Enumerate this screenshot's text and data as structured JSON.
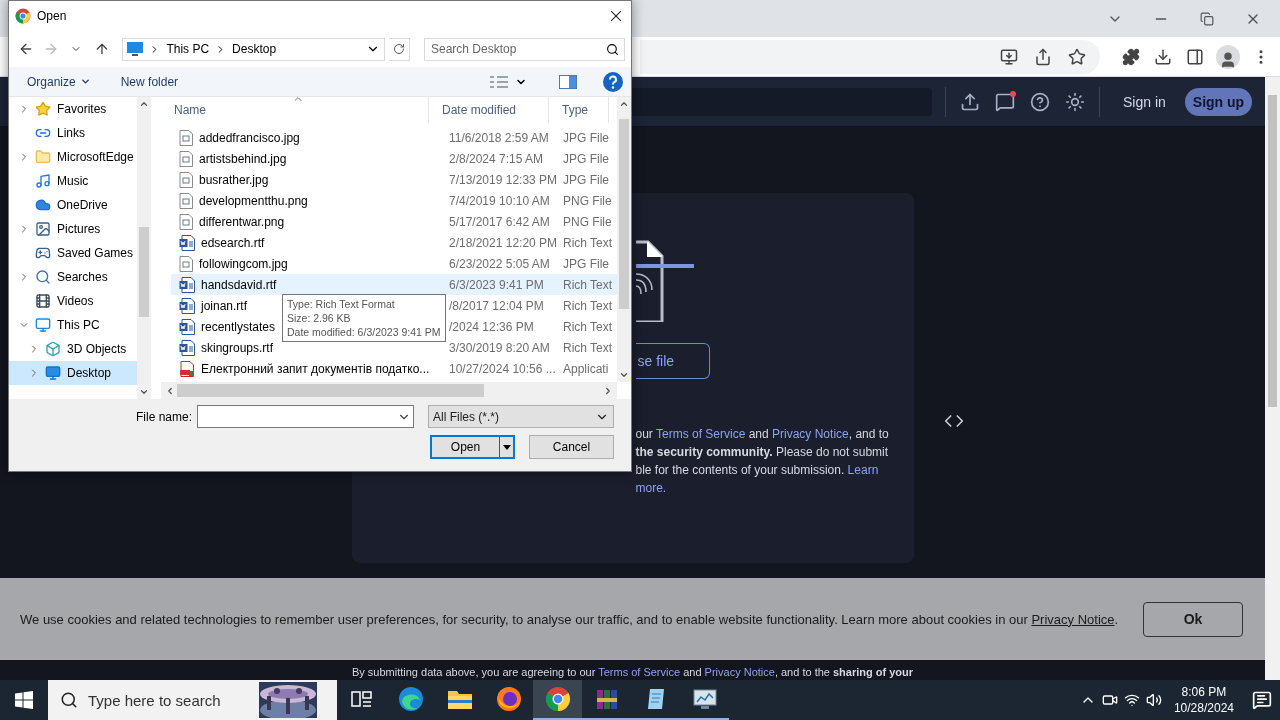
{
  "site_header": {
    "sign_in": "Sign in",
    "sign_up": "Sign up"
  },
  "upload_card": {
    "choose_button": "se file",
    "terms_lines": [
      [
        {
          "kind": "text",
          "text": "our "
        },
        {
          "kind": "link",
          "text": "Terms of Service"
        },
        {
          "kind": "text",
          "text": " and "
        },
        {
          "kind": "link",
          "text": "Privacy Notice"
        },
        {
          "kind": "text",
          "text": ", and to"
        }
      ],
      [
        {
          "kind": "text",
          "text": "**the security community.** Please do not submit"
        }
      ],
      [
        {
          "kind": "text",
          "text": "ble for the contents of your submission. "
        },
        {
          "kind": "link",
          "text": "Learn"
        }
      ],
      [
        {
          "kind": "link",
          "text": "more."
        }
      ]
    ]
  },
  "footer_text": [
    {
      "kind": "text",
      "text": "By submitting data above, you are agreeing to our "
    },
    {
      "kind": "link",
      "text": "Terms of Service"
    },
    {
      "kind": "text",
      "text": " and "
    },
    {
      "kind": "link",
      "text": "Privacy Notice"
    },
    {
      "kind": "text",
      "text": ", and to the **sharing of your**"
    }
  ],
  "cookie_banner": {
    "text": [
      {
        "kind": "text",
        "text": "We use cookies and related technologies to remember user preferences, for security, to analyse our traffic, and to enable website functionality. Learn more about cookies in our "
      },
      {
        "kind": "link",
        "text": "Privacy Notice"
      },
      {
        "kind": "text",
        "text": "."
      }
    ],
    "ok": "Ok"
  },
  "dialog": {
    "title": "Open",
    "breadcrumb": [
      "This PC",
      "Desktop"
    ],
    "search_placeholder": "Search Desktop",
    "organize": "Organize",
    "new_folder": "New folder",
    "tree": [
      {
        "label": "Favorites",
        "kind": "star",
        "expanded": false,
        "selected": false
      },
      {
        "label": "Links",
        "kind": "link",
        "selected": false
      },
      {
        "label": "MicrosoftEdge",
        "kind": "folder",
        "expanded": false,
        "selected": false
      },
      {
        "label": "Music",
        "kind": "music",
        "selected": false
      },
      {
        "label": "OneDrive",
        "kind": "cloud",
        "selected": false
      },
      {
        "label": "Pictures",
        "kind": "pictures",
        "expanded": false,
        "selected": false
      },
      {
        "label": "Saved Games",
        "kind": "games",
        "selected": false
      },
      {
        "label": "Searches",
        "kind": "search",
        "expanded": false,
        "selected": false
      },
      {
        "label": "Videos",
        "kind": "videos",
        "selected": false
      },
      {
        "label": "This PC",
        "kind": "pc",
        "expanded": true,
        "selected": false,
        "children": [
          {
            "label": "3D Objects",
            "kind": "cube",
            "expanded": false,
            "selected": false
          },
          {
            "label": "Desktop",
            "kind": "desktop",
            "expanded": false,
            "selected": true
          }
        ]
      }
    ],
    "columns": [
      "Name",
      "Date modified",
      "Type"
    ],
    "files": [
      {
        "name": "addedfrancisco.jpg",
        "modified": "11/6/2018 2:59 AM",
        "type": "JPG File",
        "hovered": false
      },
      {
        "name": "artistsbehind.jpg",
        "modified": "2/8/2024 7:15 AM",
        "type": "JPG File",
        "hovered": false
      },
      {
        "name": "busrather.jpg",
        "modified": "7/13/2019 12:33 PM",
        "type": "JPG File",
        "hovered": false
      },
      {
        "name": "developmentthu.png",
        "modified": "7/4/2019 10:10 AM",
        "type": "PNG File",
        "hovered": false
      },
      {
        "name": "differentwar.png",
        "modified": "5/17/2017 6:42 AM",
        "type": "PNG File",
        "hovered": false
      },
      {
        "name": "edsearch.rtf",
        "modified": "2/18/2021 12:20 PM",
        "type": "Rich Text",
        "kind": "document",
        "hovered": false
      },
      {
        "name": "followingcom.jpg",
        "modified": "6/23/2022 5:05 AM",
        "type": "JPG File",
        "hovered": false
      },
      {
        "name": "handsdavid.rtf",
        "modified": "6/3/2023 9:41 PM",
        "type": "Rich Text",
        "kind": "document",
        "hovered": true
      },
      {
        "name": "joinan.rtf",
        "modified": "/8/2017 12:04 PM",
        "type": "Rich Text",
        "kind": "document",
        "hovered": false
      },
      {
        "name": "recentlystates",
        "modified": "/2024 12:36 PM",
        "type": "Rich Text",
        "kind": "document",
        "hovered": false
      },
      {
        "name": "skingroups.rtf",
        "modified": "3/30/2019 8:20 AM",
        "type": "Rich Text",
        "kind": "document",
        "hovered": false
      },
      {
        "name": "Електронний запит документів податко...",
        "modified": "10/27/2024 10:56 ...",
        "type": "Applicati",
        "kind": "pdf",
        "hovered": false
      }
    ],
    "tooltip": [
      "Type: Rich Text Format",
      "Size: 2.96 KB",
      "Date modified: 6/3/2023 9:41 PM"
    ],
    "file_name_label": "File name:",
    "filter": "All Files (*.*)",
    "open": "Open",
    "cancel": "Cancel"
  },
  "taskbar": {
    "search_placeholder": "Type here to search",
    "apps": [
      {
        "kind": "task-view",
        "active": false,
        "running": false
      },
      {
        "kind": "edge",
        "active": false,
        "running": false
      },
      {
        "kind": "explorer",
        "active": false,
        "running": false
      },
      {
        "kind": "firefox",
        "active": false,
        "running": false
      },
      {
        "kind": "chrome",
        "active": true,
        "running": true
      },
      {
        "kind": "archive",
        "active": false,
        "running": true
      },
      {
        "kind": "notepad",
        "active": false,
        "running": true
      },
      {
        "kind": "monitor",
        "active": false,
        "running": true
      }
    ],
    "time": "8:06 PM",
    "date": "10/28/2024"
  }
}
